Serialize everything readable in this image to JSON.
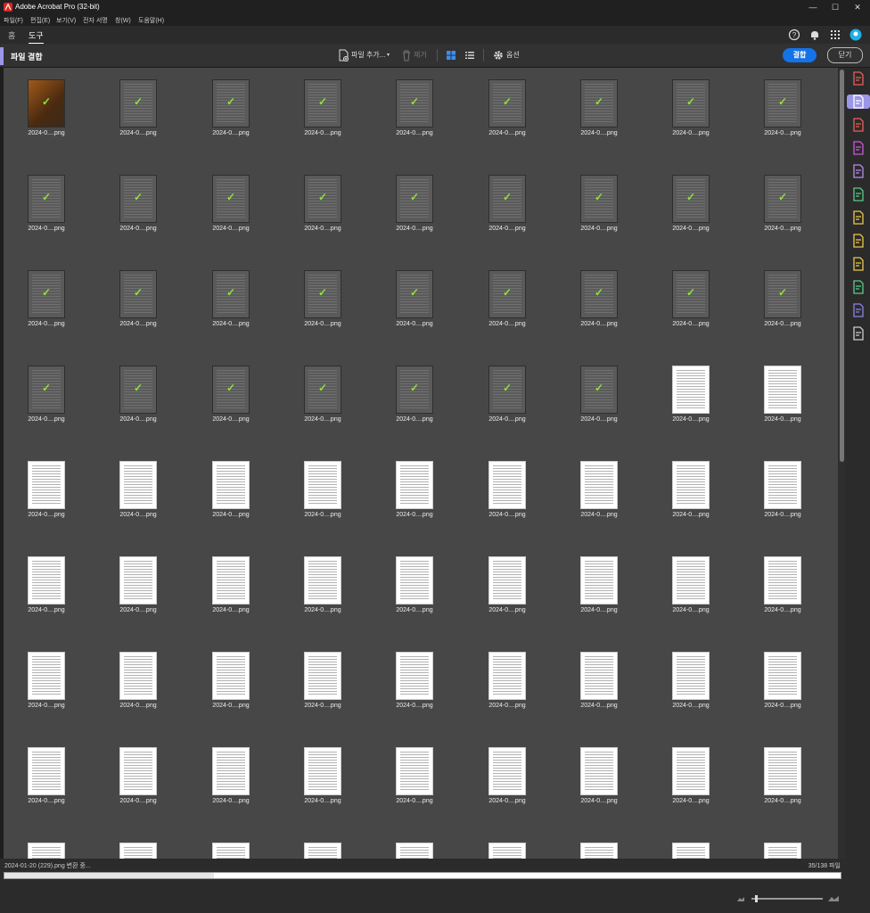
{
  "window": {
    "title": "Adobe Acrobat Pro (32-bit)",
    "minimize": "—",
    "maximize": "☐",
    "close": "✕"
  },
  "menu": [
    "파일(F)",
    "편집(E)",
    "보기(V)",
    "전자 서명",
    "창(W)",
    "도움말(H)"
  ],
  "tabs": {
    "home": "홈",
    "tools": "도구"
  },
  "toolbar": {
    "title": "파일 결합",
    "add_files": "파일 추가...",
    "remove": "제거",
    "options": "옵션",
    "combine": "결합",
    "close": "닫기"
  },
  "files": {
    "filename": "2024-0....png",
    "processed": 34,
    "columns": 9,
    "visible_rows": 9
  },
  "status": {
    "message": "2024-01-20 (229).png 변환 중...",
    "count": "35/138 파일",
    "progress": 0.25
  },
  "colors": {
    "accent": "#1473e6",
    "check": "#8fe33a",
    "panel": "#474747",
    "tool_accent": "#9b97e8"
  },
  "rightbar_icons": [
    "create-pdf-icon",
    "combine-files-icon",
    "organize-pages-icon",
    "request-esign-icon",
    "fill-sign-icon",
    "export-pdf-icon",
    "edit-pdf-icon",
    "scan-ocr-icon",
    "comment-icon",
    "print-production-icon",
    "protect-icon",
    "more-tools-icon"
  ]
}
